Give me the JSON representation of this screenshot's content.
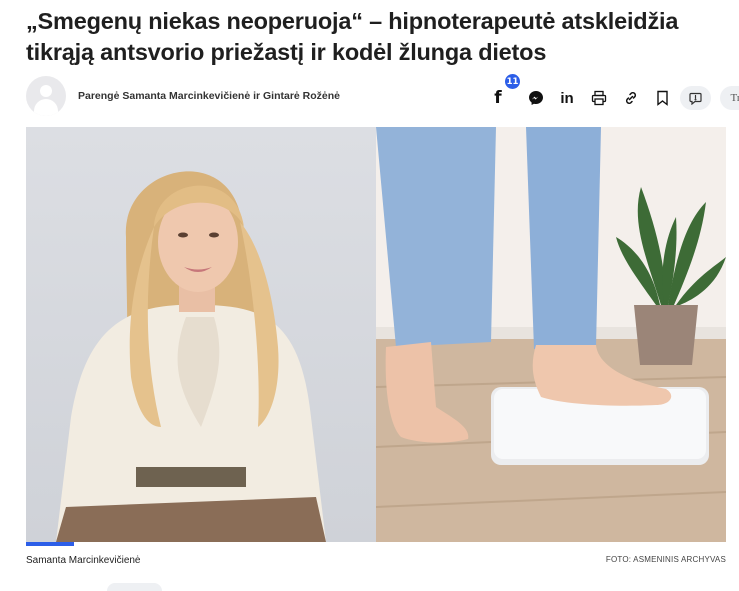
{
  "article": {
    "headline": "„Smegenų niekas neoperuoja“ – hipnoterapeutė atskleidžia tikrąją antsvorio priežastį ir kodėl žlunga dietos",
    "byline": "Parengė Samanta Marcinkevičienė ir Gintarė Rožėnė"
  },
  "share": {
    "facebook_icon": "facebook-icon",
    "facebook_count": "11",
    "messenger_icon": "messenger-icon",
    "linkedin_label": "in",
    "print_icon": "print-icon",
    "link_icon": "link-icon",
    "bookmark_icon": "bookmark-icon",
    "comment_icon": "comment-icon",
    "text_size_label": "Tr"
  },
  "photo": {
    "caption": "Samanta Marcinkevičienė",
    "credit": "FOTO: ASMENINIS ARCHYVAS"
  },
  "colors": {
    "accent": "#2c5ee8",
    "pill_bg": "#eef0f3"
  }
}
